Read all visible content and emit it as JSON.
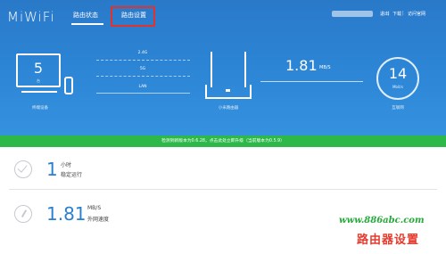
{
  "header": {
    "logo": "MiWiFi",
    "tabs": [
      {
        "label": "路由状态",
        "active": true
      },
      {
        "label": "路由设置",
        "active": false
      }
    ],
    "links": [
      "退出",
      "下载",
      "访问官网"
    ]
  },
  "devices": {
    "count": "5",
    "count_unit": "台",
    "label": "终端设备"
  },
  "bands": [
    "2.4G",
    "5G",
    "LAN"
  ],
  "router": {
    "label": "小米路由器"
  },
  "speed": {
    "value": "1.81",
    "unit": "MB/S"
  },
  "internet": {
    "value": "14",
    "unit": "Mbit/s",
    "label": "互联网"
  },
  "notice": "检测到新版本为0.6.28，点击此处立即升级（当前版本为0.5.9）",
  "stats": [
    {
      "value": "1",
      "unit": "小时",
      "label": "稳定运行",
      "icon": "check-circle-icon"
    },
    {
      "value": "1.81",
      "unit": "MB/S",
      "label": "外网速度",
      "icon": "gauge-icon"
    }
  ],
  "watermark": {
    "url": "www.886abc.com",
    "text": "路由器设置"
  },
  "colors": {
    "header": "#2d86d6",
    "notice": "#2db94a",
    "highlight": "#e0332e",
    "accent_number": "#2a7fd0"
  }
}
